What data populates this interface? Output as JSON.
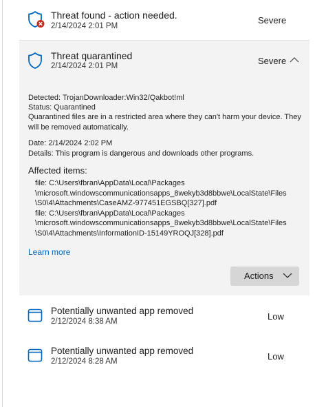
{
  "threats": [
    {
      "title": "Threat found - action needed.",
      "date": "2/14/2024 2:01 PM",
      "severity": "Severe",
      "icon": "shield-error-icon"
    },
    {
      "title": "Threat quarantined",
      "date": "2/14/2024 2:01 PM",
      "severity": "Severe",
      "icon": "shield-icon"
    }
  ],
  "details": {
    "detected": "Detected:  TrojanDownloader:Win32/Qakbot!ml",
    "status": "Status:  Quarantined",
    "description": "Quarantined files are in a restricted area where they can't harm your device. They will be removed automatically.",
    "date": "Date:  2/14/2024 2:02 PM",
    "details_text": "Details:  This program is dangerous and downloads other programs.",
    "affected_title": "Affected items:",
    "files": [
      "file: C:\\Users\\fbran\\AppData\\Local\\Packages",
      "\\microsoft.windowscommunicationsapps_8wekyb3d8bbwe\\LocalState\\Files",
      "\\S0\\4\\Attachments\\CaseAMZ-977451EGSBQ[327].pdf",
      "file: C:\\Users\\fbran\\AppData\\Local\\Packages",
      "\\microsoft.windowscommunicationsapps_8wekyb3d8bbwe\\LocalState\\Files",
      "\\S0\\4\\Attachments\\InformationID-15149YROQJ[328].pdf"
    ],
    "learn_more": "Learn more",
    "actions_label": "Actions"
  },
  "apps": [
    {
      "title": "Potentially unwanted app removed",
      "date": "2/12/2024 8:38 AM",
      "severity": "Low",
      "icon": "app-window-icon"
    },
    {
      "title": "Potentially unwanted app removed",
      "date": "2/12/2024 8:28 AM",
      "severity": "Low",
      "icon": "app-window-icon"
    }
  ],
  "colors": {
    "accent": "#0067c0",
    "error": "#c42b1c",
    "panel_bg": "#f3f3f3",
    "button_bg": "#d6d6d6"
  }
}
